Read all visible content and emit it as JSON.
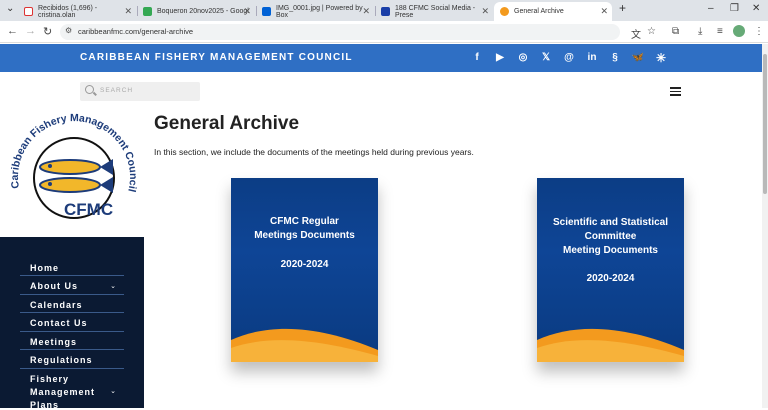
{
  "browser": {
    "tabs": [
      {
        "title": "Recibidos (1,696) - cristina.olan",
        "icon": "gmail-icon"
      },
      {
        "title": "Boqueron 20nov2025 - Googl",
        "icon": "google-drive-icon"
      },
      {
        "title": "IMG_0001.jpg | Powered by Box",
        "icon": "box-icon"
      },
      {
        "title": "188 CFMC Social Media - Prese",
        "icon": "slides-icon"
      },
      {
        "title": "General Archive",
        "icon": "cfmc-icon"
      }
    ],
    "url": "caribbeanfmc.com/general-archive"
  },
  "site": {
    "title": "CARIBBEAN FISHERY MANAGEMENT COUNCIL",
    "search_placeholder": "SEARCH",
    "social": [
      "facebook-icon",
      "youtube-icon",
      "instagram-icon",
      "x-icon",
      "threads-icon",
      "linkedin-icon",
      "threads-alt-icon",
      "bluesky-icon",
      "asterisk-icon"
    ],
    "logo": {
      "arc_text": "Caribbean Fishery Management Council",
      "abbr": "CFMC"
    }
  },
  "sidebar": {
    "items": [
      {
        "label": "Home"
      },
      {
        "label": "About Us"
      },
      {
        "label": "Calendars"
      },
      {
        "label": "Contact Us"
      },
      {
        "label": "Meetings"
      },
      {
        "label": "Regulations"
      },
      {
        "label_lines": [
          "Fishery",
          "Management",
          "Plans"
        ]
      }
    ]
  },
  "main": {
    "title": "General Archive",
    "intro": "In this section, we include the documents of the meetings held during previous years.",
    "cards": [
      {
        "lines": [
          "CFMC Regular",
          "Meetings Documents"
        ],
        "years": "2020-2024"
      },
      {
        "lines": [
          "Scientific and Statistical",
          "Committee",
          "Meeting Documents"
        ],
        "years": "2020-2024"
      }
    ]
  },
  "colors": {
    "topbar": "#2f6fc4",
    "sidebar": "#0b1a33",
    "card_blue": "#0e4596",
    "card_orange": "#f39a1e"
  }
}
